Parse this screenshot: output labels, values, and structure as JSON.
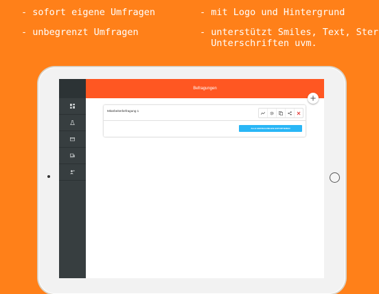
{
  "promo": {
    "line1": "- sofort eigene Umfragen",
    "line2": "- unbegrenzt Umfragen",
    "line3": "- mit Logo und Hintergrund",
    "line4": "- unterstützt Smiles, Text, Sterne,\n  Unterschriften uvm."
  },
  "app": {
    "header_title": "Befragungen",
    "sidebar_icons": [
      "dashboard-icon",
      "flask-icon",
      "credit-card-icon",
      "devices-icon",
      "user-add-icon"
    ],
    "add_icon": "plus-icon"
  },
  "survey": {
    "title": "Mitarbeiterbefragung 1",
    "actions": [
      "chart-icon",
      "gear-icon",
      "copy-icon",
      "share-icon",
      "close-icon"
    ],
    "export_label": "ALLE BEFRAGUNGEN EXPORTIEREN"
  },
  "colors": {
    "background": "#ff8019",
    "header": "#ff5722",
    "sidebar": "#373e40",
    "button": "#29b6f6",
    "delete": "#e53935"
  }
}
